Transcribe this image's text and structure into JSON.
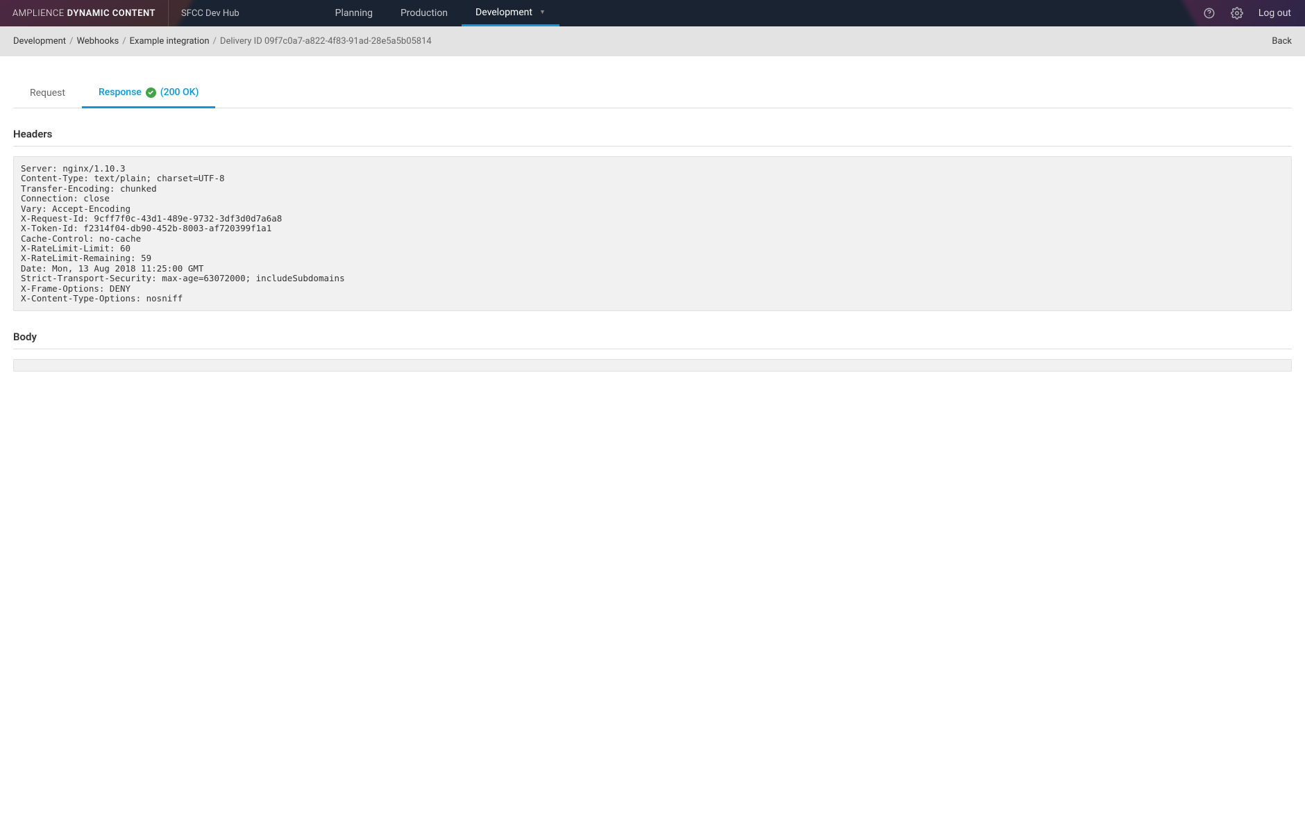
{
  "brand": {
    "thin": "AMPLIENCE",
    "bold": "DYNAMIC CONTENT"
  },
  "hub": "SFCC Dev Hub",
  "nav": {
    "planning": "Planning",
    "production": "Production",
    "development": "Development"
  },
  "logout": "Log out",
  "breadcrumb": {
    "items": [
      "Development",
      "Webhooks",
      "Example integration",
      "Delivery ID 09f7c0a7-a822-4f83-91ad-28e5a5b05814"
    ],
    "back": "Back"
  },
  "tabs": {
    "request": "Request",
    "response": "Response",
    "status": "(200 OK)"
  },
  "sections": {
    "headers_title": "Headers",
    "body_title": "Body",
    "headers_content": "Server: nginx/1.10.3\nContent-Type: text/plain; charset=UTF-8\nTransfer-Encoding: chunked\nConnection: close\nVary: Accept-Encoding\nX-Request-Id: 9cff7f0c-43d1-489e-9732-3df3d0d7a6a8\nX-Token-Id: f2314f04-db90-452b-8003-af720399f1a1\nCache-Control: no-cache\nX-RateLimit-Limit: 60\nX-RateLimit-Remaining: 59\nDate: Mon, 13 Aug 2018 11:25:00 GMT\nStrict-Transport-Security: max-age=63072000; includeSubdomains\nX-Frame-Options: DENY\nX-Content-Type-Options: nosniff"
  }
}
